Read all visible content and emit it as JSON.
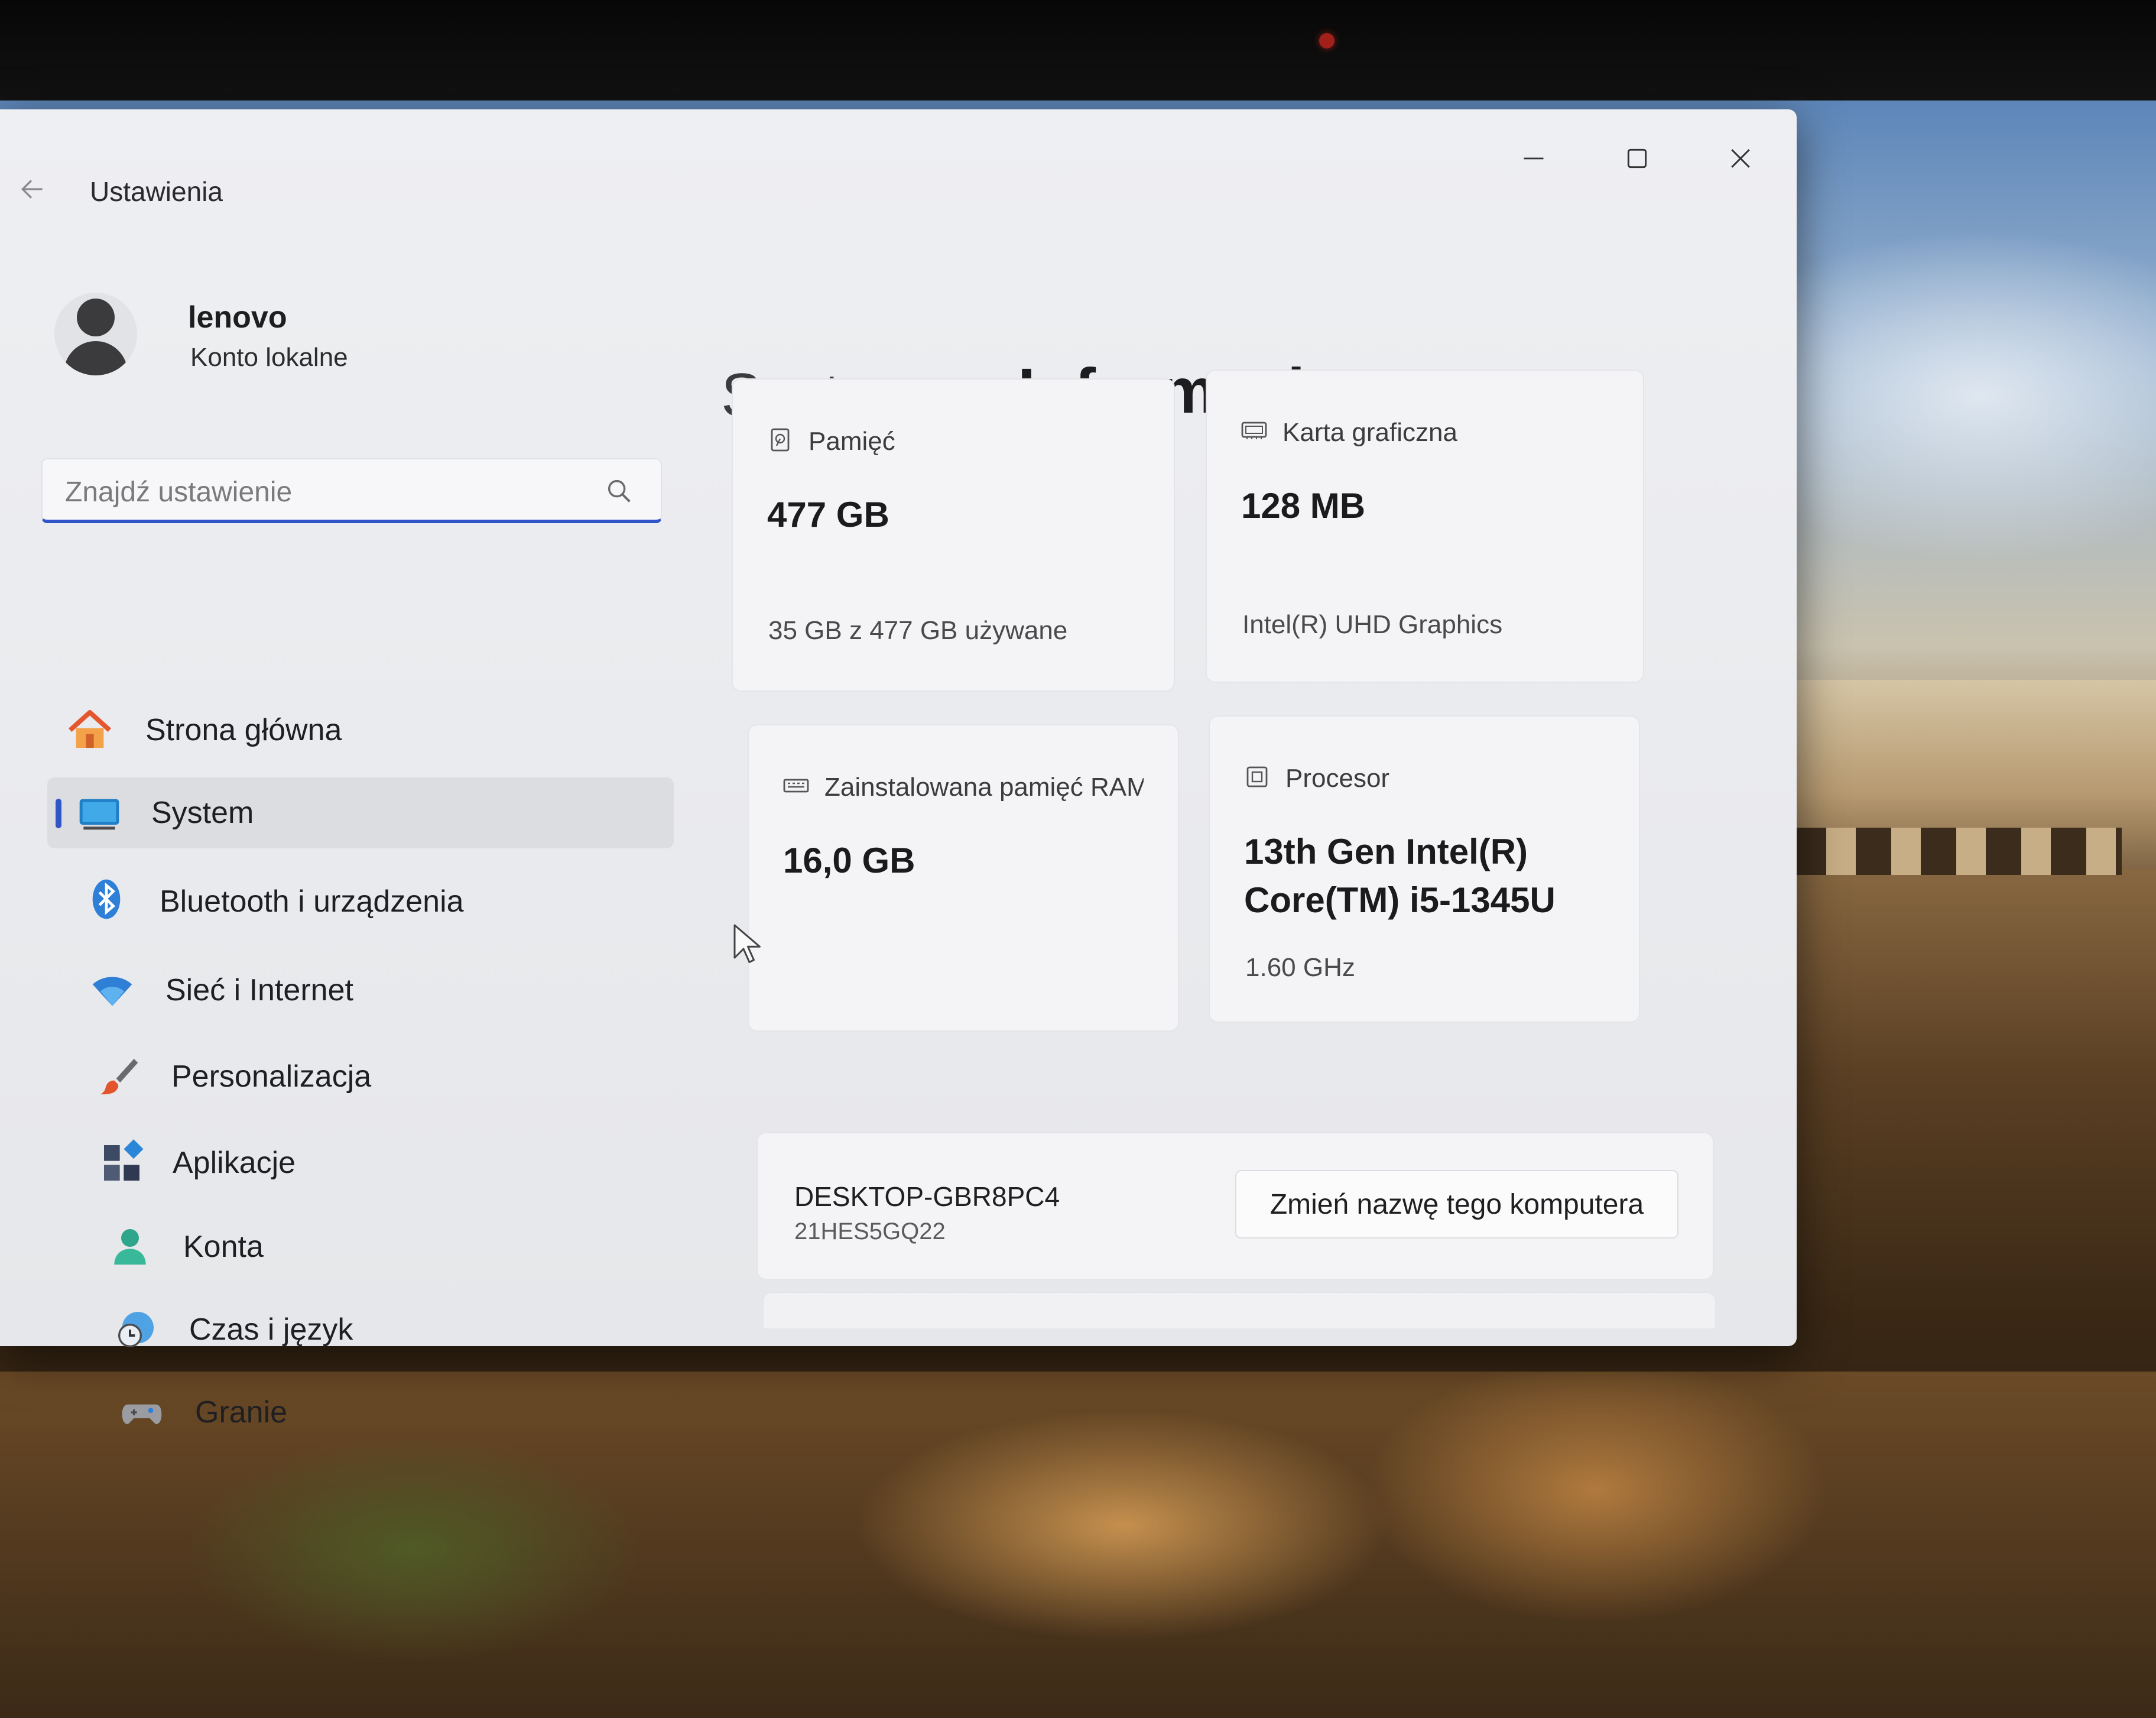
{
  "window": {
    "title": "Ustawienia",
    "controls": {
      "minimize": "minimize-icon",
      "maximize": "maximize-icon",
      "close": "close-icon"
    }
  },
  "account": {
    "name": "lenovo",
    "type": "Konto lokalne"
  },
  "search": {
    "placeholder": "Znajdź ustawienie",
    "value": ""
  },
  "nav": {
    "items": [
      {
        "label": "Strona główna",
        "icon": "home-icon",
        "active": false
      },
      {
        "label": "System",
        "icon": "system-icon",
        "active": true
      },
      {
        "label": "Bluetooth i urządzenia",
        "icon": "bluetooth-icon",
        "active": false
      },
      {
        "label": "Sieć i Internet",
        "icon": "wifi-icon",
        "active": false
      },
      {
        "label": "Personalizacja",
        "icon": "brush-icon",
        "active": false
      },
      {
        "label": "Aplikacje",
        "icon": "apps-icon",
        "active": false
      },
      {
        "label": "Konta",
        "icon": "account-icon",
        "active": false
      },
      {
        "label": "Czas i język",
        "icon": "time-language-icon",
        "active": false
      },
      {
        "label": "Granie",
        "icon": "gamepad-icon",
        "active": false
      }
    ]
  },
  "breadcrumb": {
    "parent": "System",
    "separator": "›",
    "current": "Informacje"
  },
  "specs": {
    "storage": {
      "title": "Pamięć",
      "value": "477 GB",
      "detail": "35 GB z 477 GB używane",
      "icon": "storage-icon"
    },
    "gpu": {
      "title": "Karta graficzna",
      "value": "128 MB",
      "detail": "Intel(R) UHD Graphics",
      "icon": "gpu-icon"
    },
    "ram": {
      "title": "Zainstalowana pamięć RAM",
      "value": "16,0 GB",
      "icon": "ram-icon"
    },
    "cpu": {
      "title": "Procesor",
      "value": "13th Gen Intel(R) Core(TM) i5-1345U",
      "detail": "1.60 GHz",
      "icon": "cpu-icon"
    }
  },
  "device": {
    "name": "DESKTOP-GBR8PC4",
    "model": "21HES5GQ22",
    "rename_label": "Zmień nazwę tego komputera"
  },
  "colors": {
    "accent": "#2f55c9",
    "window_bg": "#eeeff2",
    "card_bg": "#f4f4f6"
  }
}
